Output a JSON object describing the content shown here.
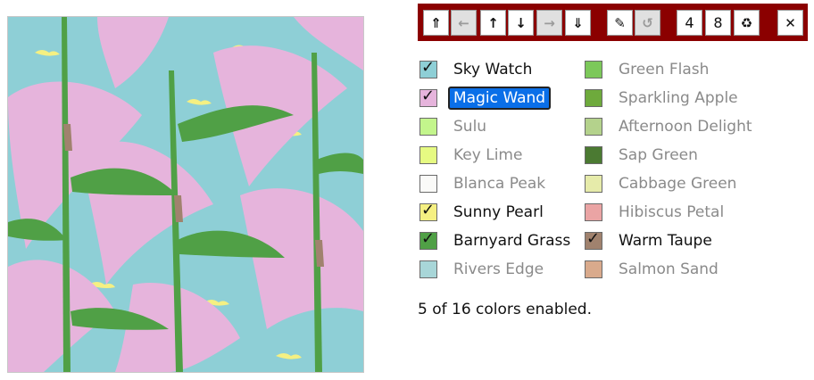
{
  "toolbar": {
    "buttons": [
      {
        "name": "move-to-top-button",
        "icon": "double-chevron-up-icon",
        "glyph": "⇑",
        "enabled": true
      },
      {
        "name": "move-left-button",
        "icon": "arrow-left-icon",
        "glyph": "←",
        "enabled": false
      },
      {
        "name": "move-up-button",
        "icon": "arrow-up-icon",
        "glyph": "↑",
        "enabled": true
      },
      {
        "name": "move-down-button",
        "icon": "arrow-down-icon",
        "glyph": "↓",
        "enabled": true
      },
      {
        "name": "move-right-button",
        "icon": "arrow-right-icon",
        "glyph": "→",
        "enabled": false
      },
      {
        "name": "move-to-bottom-button",
        "icon": "double-chevron-down-icon",
        "glyph": "⇓",
        "enabled": true
      },
      {
        "name": "edit-button",
        "icon": "pencil-icon",
        "glyph": "✎",
        "enabled": true
      },
      {
        "name": "undo-button",
        "icon": "undo-icon",
        "glyph": "↺",
        "enabled": false
      },
      {
        "name": "rows-value",
        "icon": "",
        "glyph": "4",
        "enabled": true
      },
      {
        "name": "columns-value",
        "icon": "",
        "glyph": "8",
        "enabled": true
      },
      {
        "name": "recycle-button",
        "icon": "recycle-icon",
        "glyph": "♻",
        "enabled": true
      },
      {
        "name": "close-button",
        "icon": "close-icon",
        "glyph": "✕",
        "enabled": true
      }
    ]
  },
  "colors": [
    {
      "name": "Sky Watch",
      "hex": "#8ecfd6",
      "enabled": true,
      "focused": false
    },
    {
      "name": "Magic Wand",
      "hex": "#e6b4dc",
      "enabled": true,
      "focused": true
    },
    {
      "name": "Sulu",
      "hex": "#c3f58c",
      "enabled": false,
      "focused": false
    },
    {
      "name": "Key Lime",
      "hex": "#e6fa82",
      "enabled": false,
      "focused": false
    },
    {
      "name": "Blanca Peak",
      "hex": "#fafaf8",
      "enabled": false,
      "focused": false
    },
    {
      "name": "Sunny Pearl",
      "hex": "#f5f082",
      "enabled": true,
      "focused": false
    },
    {
      "name": "Barnyard Grass",
      "hex": "#50a046",
      "enabled": true,
      "focused": false
    },
    {
      "name": "Rivers Edge",
      "hex": "#a8d6d8",
      "enabled": false,
      "focused": false
    },
    {
      "name": "Green Flash",
      "hex": "#7cc85a",
      "enabled": false,
      "focused": false
    },
    {
      "name": "Sparkling Apple",
      "hex": "#6eaa3c",
      "enabled": false,
      "focused": false
    },
    {
      "name": "Afternoon Delight",
      "hex": "#b4d28c",
      "enabled": false,
      "focused": false
    },
    {
      "name": "Sap Green",
      "hex": "#4b7a32",
      "enabled": false,
      "focused": false
    },
    {
      "name": "Cabbage Green",
      "hex": "#e6ebaa",
      "enabled": false,
      "focused": false
    },
    {
      "name": "Hibiscus Petal",
      "hex": "#eaa4a4",
      "enabled": false,
      "focused": false
    },
    {
      "name": "Warm Taupe",
      "hex": "#a0826e",
      "enabled": true,
      "focused": false
    },
    {
      "name": "Salmon Sand",
      "hex": "#d9aa8c",
      "enabled": false,
      "focused": false
    }
  ],
  "status": "5 of 16 colors enabled."
}
